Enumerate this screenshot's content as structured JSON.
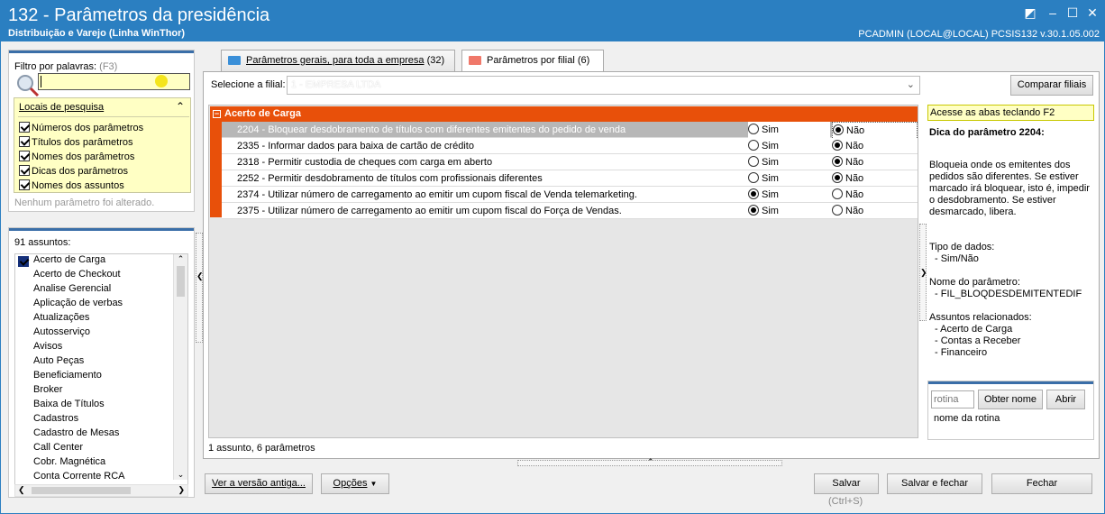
{
  "window": {
    "title": "132 - Parâmetros da presidência",
    "subtitle": "Distribuição e Varejo (Linha WinThor)",
    "user_info": "PCADMIN (LOCAL@LOCAL)   PCSIS132  v.30.1.05.002"
  },
  "filter": {
    "label": "Filtro por palavras:",
    "shortcut": "(F3)",
    "search_value": "",
    "locais_title": "Locais de pesquisa",
    "locais": [
      "Números dos parâmetros",
      "Títulos dos parâmetros",
      "Nomes dos parâmetros",
      "Dicas dos parâmetros",
      "Nomes dos assuntos"
    ],
    "status": "Nenhum parâmetro foi alterado."
  },
  "subjects": {
    "count_label": "91 assuntos:",
    "items": [
      "Acerto de Carga",
      "Acerto de Checkout",
      "Analise Gerencial",
      "Aplicação de verbas",
      "Atualizações",
      "Autosserviço",
      "Avisos",
      "Auto Peças",
      "Beneficiamento",
      "Broker",
      "Baixa de Títulos",
      "Cadastros",
      "Cadastro de Mesas",
      "Call Center",
      "Cobr. Magnética",
      "Conta Corrente RCA"
    ]
  },
  "tabs": [
    {
      "label": "Parâmetros gerais, para toda a empresa",
      "count": "(32)"
    },
    {
      "label": "Parâmetros por filial",
      "count": "(6)"
    }
  ],
  "filial": {
    "label": "Selecione a filial:",
    "value": "1 - EMPRESA LTDA",
    "compare_button": "Comparar filiais"
  },
  "group": {
    "title": "Acerto de Carga",
    "sim": "Sim",
    "nao": "Não",
    "params": [
      {
        "text": "2204 - Bloquear desdobramento de títulos com diferentes emitentes do pedido de venda",
        "value": "Não"
      },
      {
        "text": "2335 - Informar dados para baixa de cartão de crédito",
        "value": "Não"
      },
      {
        "text": "2318 - Permitir custodia de cheques com carga em aberto",
        "value": "Não"
      },
      {
        "text": "2252 - Permitir desdobramento de títulos com profissionais diferentes",
        "value": "Não"
      },
      {
        "text": "2374 - Utilizar número de carregamento ao emitir um cupom fiscal de Venda telemarketing.",
        "value": "Sim"
      },
      {
        "text": "2375 - Utilizar número de carregamento ao emitir um cupom fiscal do Força de Vendas.",
        "value": "Sim"
      }
    ]
  },
  "footer_status": "1 assunto, 6 parâmetros",
  "hint": {
    "tabs_hint": "Acesse as abas teclando F2",
    "title": "Dica do parâmetro 2204:",
    "body": "Bloqueia onde os emitentes dos pedidos são diferentes. Se estiver marcado irá bloquear, isto é, impedir o desdobramento. Se estiver desmarcado, libera.",
    "tipo_label": "Tipo de dados:",
    "tipo_value": "- Sim/Não",
    "nome_label": "Nome do parâmetro:",
    "nome_value": "- FIL_BLOQDESDEMITENTEDIF",
    "assuntos_label": "Assuntos relacionados:",
    "assuntos": [
      "- Acerto de Carga",
      "- Contas a Receber",
      "- Financeiro"
    ]
  },
  "rotina": {
    "placeholder": "rotina",
    "obter_button": "Obter nome",
    "abrir_button": "Abrir",
    "nome_label": "nome da rotina"
  },
  "buttons": {
    "versao_antiga": "Ver a versão antiga...",
    "opcoes": "Opções",
    "salvar": "Salvar",
    "salvar_shortcut": "(Ctrl+S)",
    "salvar_fechar": "Salvar e fechar",
    "fechar": "Fechar"
  },
  "colors": {
    "titlebar": "#2b7fc1",
    "group_header": "#e8500a",
    "hint_yellow": "#ffffc4"
  }
}
